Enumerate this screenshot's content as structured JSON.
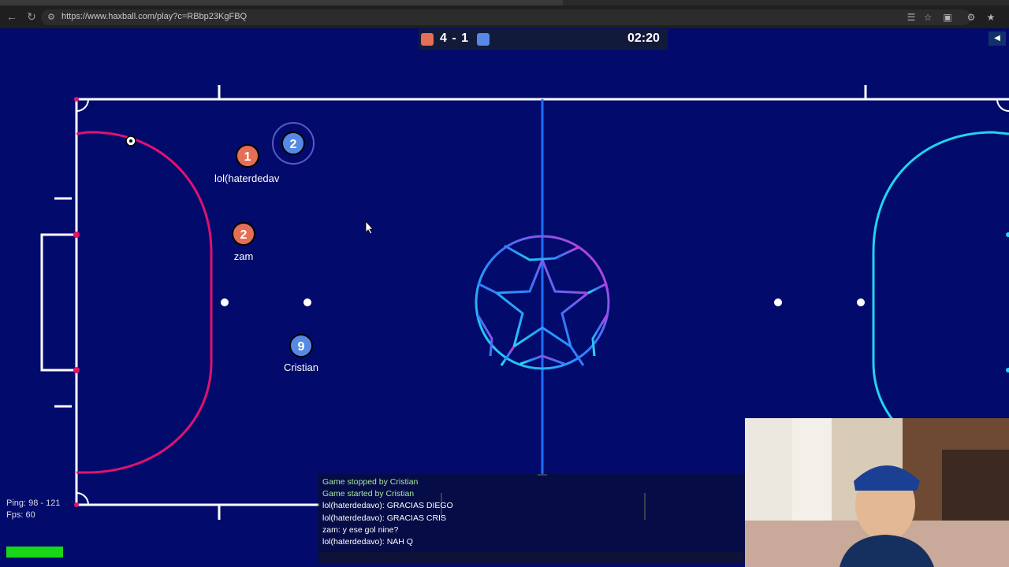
{
  "browser": {
    "url": "https://www.haxball.com/play?c=RBbp23KgFBQ",
    "back_icon": "arrow-left-icon",
    "reload_icon": "reload-icon"
  },
  "scoreboard": {
    "score": "4 - 1",
    "time": "02:20",
    "red_color": "#e56e56",
    "blue_color": "#5689e5"
  },
  "players": [
    {
      "number": "1",
      "name": "lol(haterdedav",
      "team": "red"
    },
    {
      "number": "2",
      "name": "",
      "team": "blue"
    },
    {
      "number": "2",
      "name": "zam",
      "team": "red"
    },
    {
      "number": "9",
      "name": "Cristian",
      "team": "blue"
    }
  ],
  "stats": {
    "ping": "Ping: 98 - 121",
    "fps": "Fps: 60"
  },
  "chat": {
    "lines": [
      "Game stopped by Cristian",
      "Game started by Cristian",
      "lol(haterdedavo): GRACIAS DIEGO",
      "lol(haterdedavo): GRACIAS CRIS",
      "zam: y ese gol nine?",
      "lol(haterdedavo): NAH Q"
    ]
  },
  "colors": {
    "field": "#020b6b",
    "left_arc": "#e0126f",
    "right_arc": "#22d3f0",
    "midline": "#1e6dff"
  }
}
